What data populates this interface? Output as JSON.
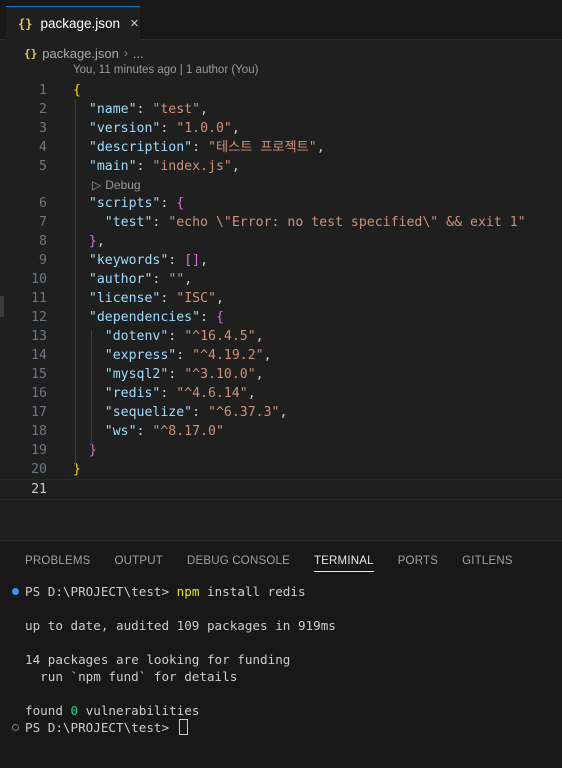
{
  "tab": {
    "icon": "{}",
    "label": "package.json",
    "close": "×"
  },
  "breadcrumb": {
    "icon": "{}",
    "file": "package.json",
    "sep": "›",
    "more": "..."
  },
  "blame": "You, 11 minutes ago | 1 author (You)",
  "codelens": {
    "icon": "▷",
    "label": "Debug"
  },
  "lines": [
    {
      "n": "1",
      "parts": [
        [
          "b1",
          "{"
        ]
      ]
    },
    {
      "n": "2",
      "parts": [
        [
          "p",
          "  "
        ],
        [
          "k",
          "\"name\""
        ],
        [
          "p",
          ": "
        ],
        [
          "s",
          "\"test\""
        ],
        [
          "p",
          ","
        ]
      ]
    },
    {
      "n": "3",
      "parts": [
        [
          "p",
          "  "
        ],
        [
          "k",
          "\"version\""
        ],
        [
          "p",
          ": "
        ],
        [
          "s",
          "\"1.0.0\""
        ],
        [
          "p",
          ","
        ]
      ]
    },
    {
      "n": "4",
      "parts": [
        [
          "p",
          "  "
        ],
        [
          "k",
          "\"description\""
        ],
        [
          "p",
          ": "
        ],
        [
          "s",
          "\"테스트 프로젝트\""
        ],
        [
          "p",
          ","
        ]
      ]
    },
    {
      "n": "5",
      "parts": [
        [
          "p",
          "  "
        ],
        [
          "k",
          "\"main\""
        ],
        [
          "p",
          ": "
        ],
        [
          "s",
          "\"index.js\""
        ],
        [
          "p",
          ","
        ]
      ]
    },
    {
      "n": "6",
      "parts": [
        [
          "p",
          "  "
        ],
        [
          "k",
          "\"scripts\""
        ],
        [
          "p",
          ": "
        ],
        [
          "b2",
          "{"
        ]
      ]
    },
    {
      "n": "7",
      "parts": [
        [
          "p",
          "    "
        ],
        [
          "k",
          "\"test\""
        ],
        [
          "p",
          ": "
        ],
        [
          "s",
          "\"echo \\\"Error: no test specified\\\" && exit 1\""
        ]
      ]
    },
    {
      "n": "8",
      "parts": [
        [
          "p",
          "  "
        ],
        [
          "b2",
          "}"
        ],
        [
          "p",
          ","
        ]
      ]
    },
    {
      "n": "9",
      "parts": [
        [
          "p",
          "  "
        ],
        [
          "k",
          "\"keywords\""
        ],
        [
          "p",
          ": "
        ],
        [
          "b2",
          "[]"
        ],
        [
          "p",
          ","
        ]
      ]
    },
    {
      "n": "10",
      "parts": [
        [
          "p",
          "  "
        ],
        [
          "k",
          "\"author\""
        ],
        [
          "p",
          ": "
        ],
        [
          "s",
          "\"\""
        ],
        [
          "p",
          ","
        ]
      ]
    },
    {
      "n": "11",
      "parts": [
        [
          "p",
          "  "
        ],
        [
          "k",
          "\"license\""
        ],
        [
          "p",
          ": "
        ],
        [
          "s",
          "\"ISC\""
        ],
        [
          "p",
          ","
        ]
      ]
    },
    {
      "n": "12",
      "parts": [
        [
          "p",
          "  "
        ],
        [
          "k",
          "\"dependencies\""
        ],
        [
          "p",
          ": "
        ],
        [
          "b2",
          "{"
        ]
      ]
    },
    {
      "n": "13",
      "parts": [
        [
          "p",
          "    "
        ],
        [
          "k",
          "\"dotenv\""
        ],
        [
          "p",
          ": "
        ],
        [
          "s",
          "\"^16.4.5\""
        ],
        [
          "p",
          ","
        ]
      ]
    },
    {
      "n": "14",
      "parts": [
        [
          "p",
          "    "
        ],
        [
          "k",
          "\"express\""
        ],
        [
          "p",
          ": "
        ],
        [
          "s",
          "\"^4.19.2\""
        ],
        [
          "p",
          ","
        ]
      ]
    },
    {
      "n": "15",
      "parts": [
        [
          "p",
          "    "
        ],
        [
          "k",
          "\"mysql2\""
        ],
        [
          "p",
          ": "
        ],
        [
          "s",
          "\"^3.10.0\""
        ],
        [
          "p",
          ","
        ]
      ]
    },
    {
      "n": "16",
      "parts": [
        [
          "p",
          "    "
        ],
        [
          "k",
          "\"redis\""
        ],
        [
          "p",
          ": "
        ],
        [
          "s",
          "\"^4.6.14\""
        ],
        [
          "p",
          ","
        ]
      ]
    },
    {
      "n": "17",
      "parts": [
        [
          "p",
          "    "
        ],
        [
          "k",
          "\"sequelize\""
        ],
        [
          "p",
          ": "
        ],
        [
          "s",
          "\"^6.37.3\""
        ],
        [
          "p",
          ","
        ]
      ]
    },
    {
      "n": "18",
      "parts": [
        [
          "p",
          "    "
        ],
        [
          "k",
          "\"ws\""
        ],
        [
          "p",
          ": "
        ],
        [
          "s",
          "\"^8.17.0\""
        ]
      ]
    },
    {
      "n": "19",
      "parts": [
        [
          "p",
          "  "
        ],
        [
          "b2",
          "}"
        ]
      ]
    },
    {
      "n": "20",
      "parts": [
        [
          "b1",
          "}"
        ]
      ]
    },
    {
      "n": "21",
      "parts": []
    }
  ],
  "panel": {
    "tabs": [
      "PROBLEMS",
      "OUTPUT",
      "DEBUG CONSOLE",
      "TERMINAL",
      "PORTS",
      "GITLENS"
    ],
    "active_tab": "TERMINAL"
  },
  "terminal": {
    "prompt": "PS D:\\PROJECT\\test> ",
    "command_bin": "npm",
    "command_args": " install redis",
    "out1": "up to date, audited 109 packages in 919ms",
    "out2": "14 packages are looking for funding",
    "out3": "  run `npm fund` for details",
    "out4_a": "found ",
    "out4_b": "0",
    "out4_c": " vulnerabilities",
    "prompt2": "PS D:\\PROJECT\\test> "
  }
}
